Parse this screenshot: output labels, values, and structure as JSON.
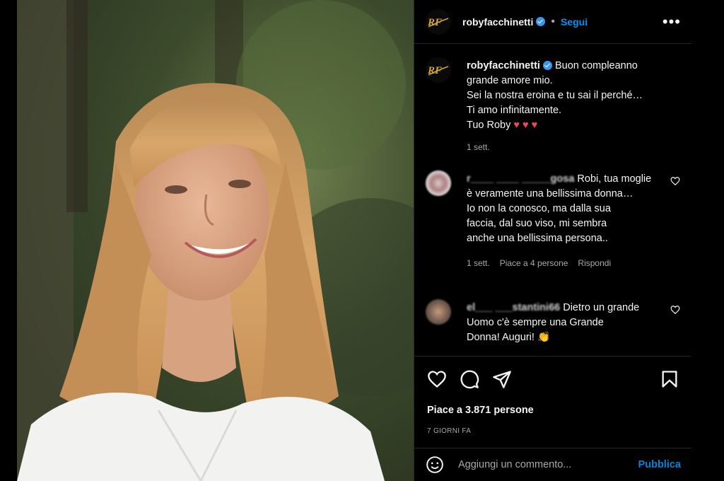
{
  "post": {
    "username": "robyfacchinetti",
    "follow_label": "Segui",
    "dot": "•",
    "more_label": "•••",
    "likes": "Piace a 3.871 persone",
    "date": "7 GIORNI FA"
  },
  "caption": {
    "username": "robyfacchinetti",
    "lines": [
      "Buon compleanno",
      "grande amore mio.",
      "Sei la nostra eroina e tu sai il perché…",
      "Ti amo infinitamente.",
      "Tuo Roby"
    ],
    "hearts": "♥ ♥ ♥",
    "time": "1 sett."
  },
  "comments": [
    {
      "username": "r____ ____ _____gosa",
      "lines": [
        "Robi, tua moglie",
        "è veramente una bellissima donna…",
        "Io non la conosco, ma dalla sua",
        "faccia, dal suo viso, mi sembra",
        "anche una bellissima persona.."
      ],
      "time": "1 sett.",
      "likes": "Piace a 4 persone",
      "reply": "Rispondi"
    },
    {
      "username": "el___ ___stantini66",
      "lines": [
        "Dietro un grande",
        "Uomo c'è sempre una Grande",
        "Donna! Auguri!"
      ],
      "emoji": "👏"
    }
  ],
  "add_comment": {
    "placeholder": "Aggiungi un commento...",
    "publish": "Pubblica"
  },
  "colors": {
    "accent": "#0095f6",
    "background": "#000000",
    "heart": "#ed4956"
  },
  "icons": [
    "rf-logo-icon",
    "verified-icon",
    "heart-icon",
    "comment-icon",
    "share-icon",
    "bookmark-icon",
    "emoji-icon"
  ]
}
